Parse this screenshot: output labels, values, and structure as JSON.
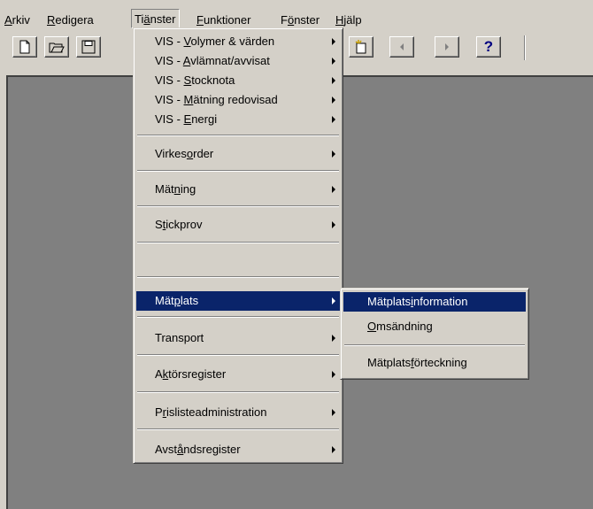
{
  "menubar": {
    "items": [
      {
        "label": "Arkiv",
        "mnemonic": "A",
        "rest": "rkiv"
      },
      {
        "label": "Redigera",
        "mnemonic": "R",
        "rest": "edigera"
      },
      {
        "label": "Tjänster",
        "pre": "Ti",
        "mnemonic": "ä",
        "rest": "nster"
      },
      {
        "label": "Funktioner",
        "mnemonic": "F",
        "rest": "unktioner"
      },
      {
        "label": "Fönster",
        "pre": "F",
        "mnemonic": "ö",
        "rest": "nster"
      },
      {
        "label": "Hjälp",
        "mnemonic": "H",
        "rest": "jälp"
      }
    ]
  },
  "toolbar": {
    "icons": [
      "new-document-icon",
      "open-folder-icon",
      "save-disk-icon",
      "new-item-icon",
      "previous-arrow-icon",
      "next-arrow-icon",
      "help-icon"
    ],
    "help_label": "?"
  },
  "tjanster_menu": {
    "items": [
      {
        "pre": "VIS - ",
        "mnemonic": "V",
        "rest": "olymer & värden"
      },
      {
        "pre": "VIS - ",
        "mnemonic": "A",
        "rest": "vlämnat/avvisat"
      },
      {
        "pre": "VIS - ",
        "mnemonic": "S",
        "rest": "tocknota"
      },
      {
        "pre": "VIS - ",
        "mnemonic": "M",
        "rest": "ätning redovisad"
      },
      {
        "pre": "VIS - ",
        "mnemonic": "E",
        "rest": "nergi"
      },
      {
        "pre": "Virkes",
        "mnemonic": "o",
        "rest": "rder"
      },
      {
        "pre": "Mät",
        "mnemonic": "n",
        "rest": "ing"
      },
      {
        "pre": "S",
        "mnemonic": "t",
        "rest": "ickprov"
      },
      {
        "pre": "Mät",
        "mnemonic": "p",
        "rest": "lats"
      },
      {
        "pre": "Transport",
        "mnemonic": "",
        "rest": ""
      },
      {
        "pre": "A",
        "mnemonic": "k",
        "rest": "törsregister"
      },
      {
        "pre": "P",
        "mnemonic": "r",
        "rest": "islisteadministration"
      },
      {
        "pre": "Avst",
        "mnemonic": "å",
        "rest": "ndsregister"
      }
    ]
  },
  "matplats_submenu": {
    "items": [
      {
        "pre": "Mätplats",
        "mnemonic": "i",
        "rest": "nformation"
      },
      {
        "pre": "",
        "mnemonic": "O",
        "rest": "msändning"
      },
      {
        "pre": "Mätplats",
        "mnemonic": "f",
        "rest": "örteckning"
      }
    ]
  },
  "colors": {
    "face": "#d4d0c8",
    "client": "#808080",
    "highlight": "#0a246a"
  }
}
